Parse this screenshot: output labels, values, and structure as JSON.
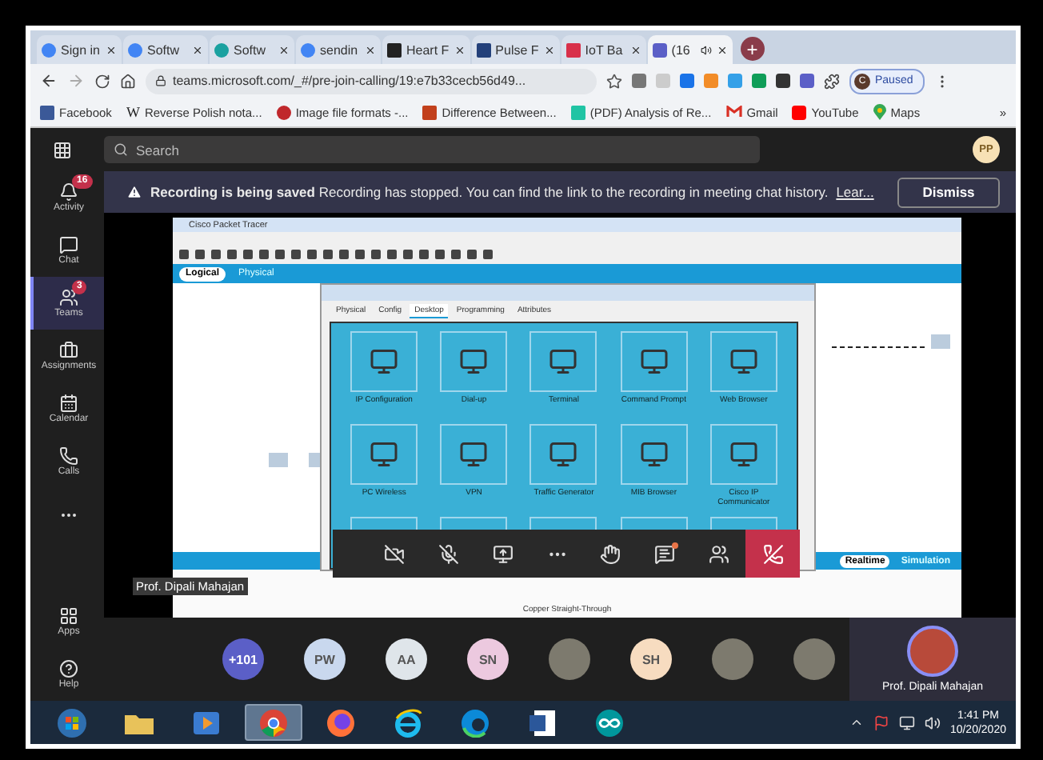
{
  "browser": {
    "tabs": [
      {
        "kind": "g",
        "label": "Sign in",
        "selected": false
      },
      {
        "kind": "g",
        "label": "Softw",
        "selected": false
      },
      {
        "kind": "disc",
        "label": "Softw",
        "selected": false
      },
      {
        "kind": "g",
        "label": "sendin",
        "selected": false
      },
      {
        "kind": "frame",
        "label": "Heart F",
        "selected": false
      },
      {
        "kind": "square",
        "label": "Pulse F",
        "selected": false
      },
      {
        "kind": "wave",
        "label": "IoT Ba",
        "selected": false
      },
      {
        "kind": "people",
        "label": "(16",
        "selected": true
      }
    ],
    "new_tab": "+",
    "url": "teams.microsoft.com/_#/pre-join-calling/19:e7b33cecb56d49...",
    "profile": {
      "initial": "C",
      "label": "Paused"
    },
    "bookmarks": [
      {
        "kind": "fb",
        "label": "Facebook"
      },
      {
        "kind": "letter",
        "mark": "W",
        "label": "Reverse Polish nota..."
      },
      {
        "kind": "blob",
        "label": "Image file formats -..."
      },
      {
        "kind": "redsquare",
        "label": "Difference Between..."
      },
      {
        "kind": "tealsquare",
        "label": "(PDF) Analysis of Re..."
      },
      {
        "kind": "mail",
        "label": "Gmail"
      },
      {
        "kind": "play",
        "label": "YouTube"
      },
      {
        "kind": "pin",
        "label": "Maps"
      }
    ],
    "more": "»"
  },
  "teams": {
    "search": {
      "placeholder": "Search"
    },
    "avatar": "PP",
    "rail": [
      {
        "kind": "bell",
        "label": "Activity",
        "badge": "16",
        "selected": false
      },
      {
        "kind": "chat",
        "label": "Chat",
        "selected": false
      },
      {
        "kind": "teams",
        "label": "Teams",
        "badge": "3",
        "selected": true
      },
      {
        "kind": "bag",
        "label": "Assignments",
        "selected": false
      },
      {
        "kind": "calendar",
        "label": "Calendar",
        "selected": false
      },
      {
        "kind": "phone",
        "label": "Calls",
        "selected": false
      },
      {
        "kind": "more",
        "selected": false
      }
    ],
    "rail_bottom": [
      {
        "kind": "apps",
        "label": "Apps"
      },
      {
        "kind": "help",
        "label": "Help"
      }
    ],
    "banner": {
      "title": "Recording is being saved",
      "message": "Recording has stopped. You can find the link to the recording in meeting chat history.",
      "link": "Lear...",
      "button": "Dismiss"
    },
    "shared_screen": {
      "app_title": "Cisco Packet Tracer",
      "views": [
        {
          "label": "Logical",
          "selected": true
        },
        {
          "label": "Physical",
          "selected": false
        }
      ],
      "dialog": {
        "tabs": [
          {
            "label": "Physical",
            "selected": false
          },
          {
            "label": "Config",
            "selected": false
          },
          {
            "label": "Desktop",
            "selected": true
          },
          {
            "label": "Programming",
            "selected": false
          },
          {
            "label": "Attributes",
            "selected": false
          }
        ],
        "apps": [
          {
            "kind": "full",
            "label": "IP Configuration"
          },
          {
            "kind": "full",
            "label": "Dial-up"
          },
          {
            "kind": "full",
            "label": "Terminal"
          },
          {
            "kind": "full",
            "label": "Command Prompt"
          },
          {
            "kind": "full",
            "label": "Web Browser"
          },
          {
            "kind": "full",
            "label": "PC Wireless"
          },
          {
            "kind": "full",
            "label": "VPN"
          },
          {
            "kind": "full",
            "label": "Traffic Generator"
          },
          {
            "kind": "full",
            "label": "MIB Browser"
          },
          {
            "kind": "full",
            "label": "Cisco IP Communicator"
          },
          {
            "kind": "cut"
          },
          {
            "kind": "cut"
          },
          {
            "kind": "cut"
          },
          {
            "kind": "cut"
          },
          {
            "kind": "cut"
          }
        ]
      },
      "modes": [
        {
          "label": "Realtime",
          "selected": true
        },
        {
          "label": "Simulation",
          "selected": false
        }
      ],
      "cable": "Copper Straight-Through"
    },
    "presenter": "Prof. Dipali Mahajan",
    "controls": {
      "camera_on": false,
      "mic_on": false,
      "chat_unread": true,
      "items": [
        {
          "kind": "camera"
        },
        {
          "kind": "mic"
        },
        {
          "kind": "share"
        },
        {
          "kind": "more"
        },
        {
          "kind": "hand"
        },
        {
          "kind": "chat"
        },
        {
          "kind": "people"
        },
        {
          "kind": "leave"
        }
      ]
    },
    "participants": [
      {
        "kind": "count",
        "label": "+101",
        "color": "#5b5fc7"
      },
      {
        "kind": "initials",
        "label": "PW",
        "color": "#c9d8ee"
      },
      {
        "kind": "initials",
        "label": "AA",
        "color": "#dfe5ea"
      },
      {
        "kind": "initials",
        "label": "SN",
        "color": "#ecc9df"
      },
      {
        "kind": "photo"
      },
      {
        "kind": "initials",
        "label": "SH",
        "color": "#f7dcc0"
      },
      {
        "kind": "photo"
      },
      {
        "kind": "photo"
      }
    ],
    "self_tile": {
      "name": "Prof. Dipali Mahajan"
    }
  },
  "taskbar": {
    "apps": [
      {
        "kind": "start",
        "selected": false
      },
      {
        "kind": "folder",
        "selected": false
      },
      {
        "kind": "media",
        "selected": false
      },
      {
        "kind": "chrome",
        "selected": true
      },
      {
        "kind": "fox",
        "selected": false
      },
      {
        "kind": "ie",
        "selected": false
      },
      {
        "kind": "edge",
        "selected": false
      },
      {
        "kind": "word",
        "selected": false
      },
      {
        "kind": "infinity",
        "selected": false
      }
    ],
    "clock": {
      "time": "1:41 PM",
      "date": "10/20/2020"
    }
  }
}
